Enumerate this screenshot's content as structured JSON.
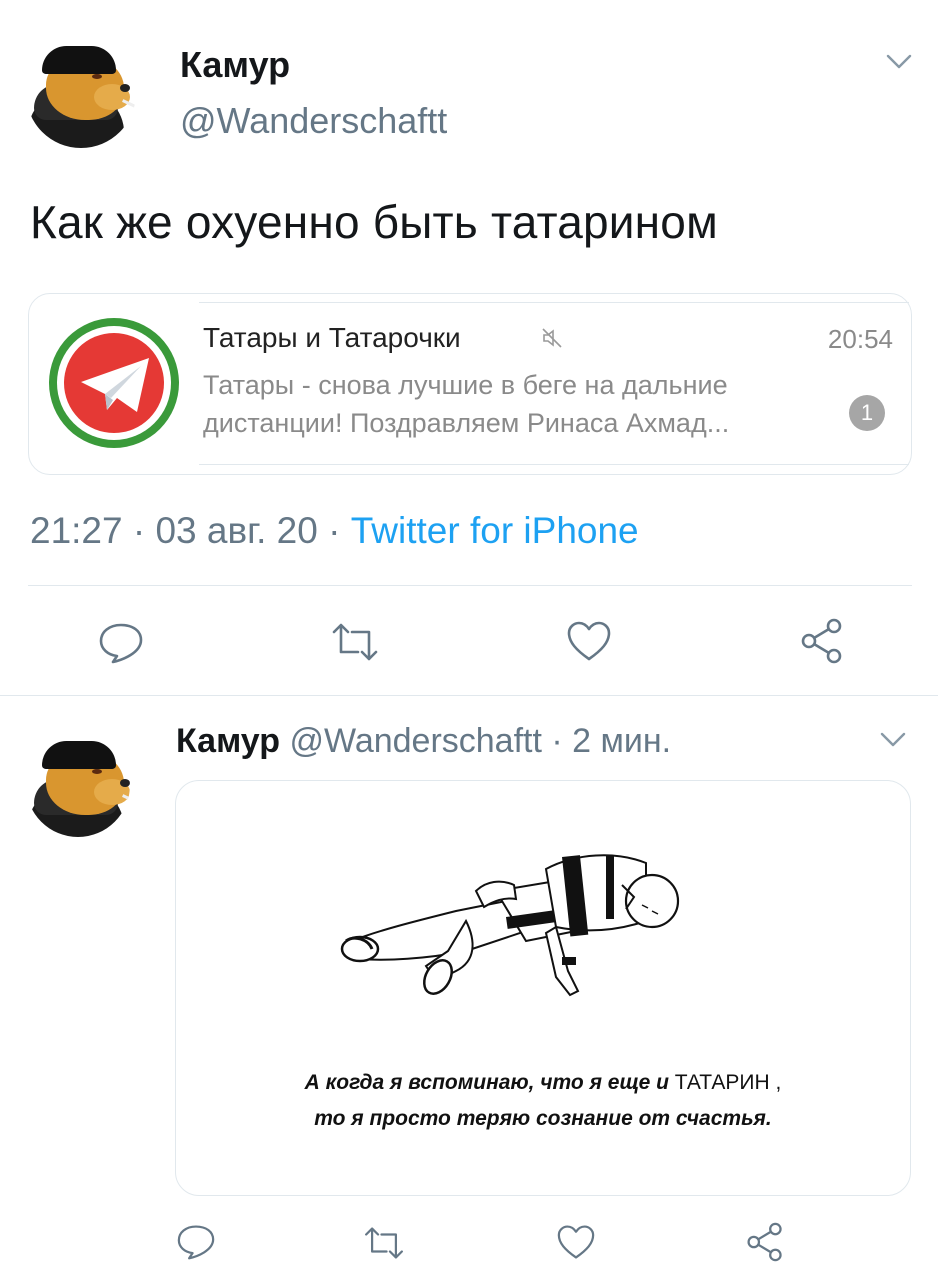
{
  "tweet": {
    "author_name": "Камур",
    "author_handle": "@Wanderschaftt",
    "text": "Как же охуенно быть татарином",
    "quoted": {
      "chat_title": "Татары и Татарочки",
      "time": "20:54",
      "preview": "Татары - снова лучшие в беге на дальние дистанции! Поздравляем Ринаса Ахмад...",
      "unread_count": "1",
      "muted_icon": "mute-icon",
      "logo_icon": "telegram-logo-icon"
    },
    "timestamp": "21:27 · 03 авг. 20 · ",
    "source": "Twitter for iPhone",
    "actions": [
      "reply-icon",
      "retweet-icon",
      "like-icon",
      "share-icon"
    ]
  },
  "reply": {
    "author_name": "Камур",
    "author_handle": "@Wanderschaftt",
    "time_ago": " · 2 мин.",
    "image_caption_line1_italic": "А когда я вспоминаю, что я еще и ",
    "image_caption_line1_upper": "ТАТАРИН ,",
    "image_caption_line2": "то я просто теряю сознание от счастья.",
    "actions": [
      "reply-icon",
      "retweet-icon",
      "like-icon",
      "share-icon"
    ]
  },
  "colors": {
    "text_primary": "#14171a",
    "text_secondary": "#657786",
    "link": "#1da1f2",
    "border": "#e1e8ed",
    "telegram_red": "#e53935",
    "telegram_green": "#3a9a3a"
  }
}
